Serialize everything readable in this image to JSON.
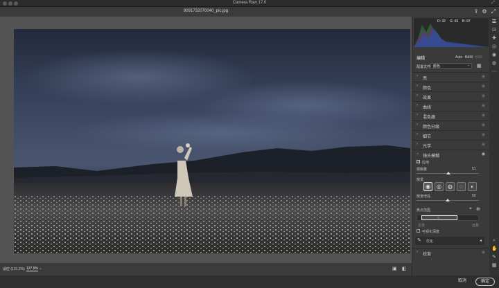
{
  "window": {
    "title": "Camera Raw 17.0"
  },
  "toolbar": {
    "file_name": "9091732070040_pic.jpg",
    "export_icon": "export-icon",
    "settings_icon": "gear-icon"
  },
  "histogram": {
    "r": "R: 32",
    "g": "G: 66",
    "b": "B: 87"
  },
  "panel": {
    "title": "编辑",
    "auto": "Auto",
    "bw": "B&W",
    "hdr": "HDR",
    "profile_label": "配置文件",
    "profile_value": "颜色",
    "sections": [
      {
        "label": "亮"
      },
      {
        "label": "颜色"
      },
      {
        "label": "效果"
      },
      {
        "label": "曲线"
      },
      {
        "label": "混色器"
      },
      {
        "label": "颜色分级"
      },
      {
        "label": "细节"
      },
      {
        "label": "光学"
      }
    ],
    "lens_blur": {
      "label": "镜头模糊",
      "apply_label": "应用",
      "blur_amount_label": "模糊量",
      "blur_amount_value": "51",
      "blur_amount_fraction": 0.51,
      "bokeh_label": "散景",
      "highlight_label": "散景增强",
      "highlight_value": "50",
      "highlight_fraction": 0.5,
      "focus_label": "焦点范围",
      "near_label": "近景",
      "far_label": "远景",
      "visualize_label": "可视化深度",
      "refine_label": "优化"
    },
    "calibration_label": "校准"
  },
  "status": {
    "zoom_fit": "适应 (131.2%)",
    "zoom_value": "127.9%"
  },
  "footer": {
    "cancel": "取消",
    "ok": "确定"
  }
}
